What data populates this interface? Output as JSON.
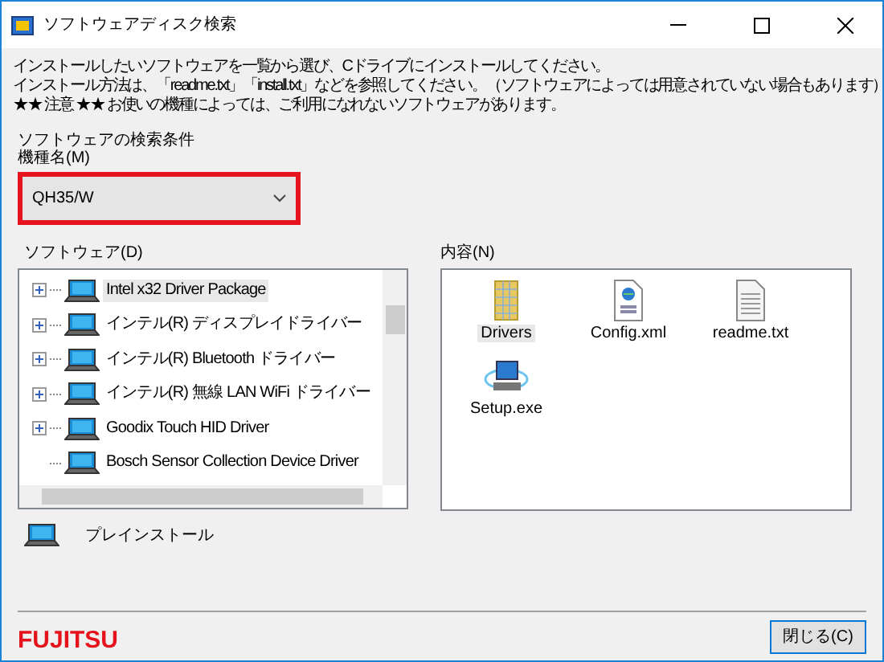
{
  "window": {
    "title": "ソフトウェアディスク検索"
  },
  "instructions": [
    "インストールしたいソフトウェアを一覧から選び、Cドライブにインストールしてください。",
    "インストール方法は、「readme.txt」「install.txt」などを参照してください。（ソフトウェアによっては用意されていない場合もあります）",
    "★★ 注意 ★★ お使いの機種によっては、ご利用になれないソフトウェアがあります。"
  ],
  "search_conditions": {
    "heading": "ソフトウェアの検索条件",
    "model_label": "機種名(M)",
    "model_value": "QH35/W"
  },
  "software": {
    "label": "ソフトウェア(D)",
    "items": [
      {
        "name": "Intel x32 Driver Package",
        "expandable": true,
        "selected": true
      },
      {
        "name": "インテル(R) ディスプレイドライバー",
        "expandable": true,
        "selected": false
      },
      {
        "name": "インテル(R) Bluetooth ドライバー",
        "expandable": true,
        "selected": false
      },
      {
        "name": "インテル(R) 無線 LAN WiFi ドライバー",
        "expandable": true,
        "selected": false
      },
      {
        "name": "Goodix Touch HID Driver",
        "expandable": true,
        "selected": false
      },
      {
        "name": "Bosch Sensor Collection Device Driver",
        "expandable": false,
        "selected": false
      }
    ]
  },
  "contents": {
    "label": "内容(N)",
    "items": [
      {
        "name": "Drivers",
        "kind": "folder",
        "selected": true
      },
      {
        "name": "Config.xml",
        "kind": "xml",
        "selected": false
      },
      {
        "name": "readme.txt",
        "kind": "text",
        "selected": false
      },
      {
        "name": "Setup.exe",
        "kind": "setup",
        "selected": false
      }
    ]
  },
  "legend": {
    "label": "プレインストール"
  },
  "logo": "FUJITSU",
  "close_button": "閉じる(C)"
}
